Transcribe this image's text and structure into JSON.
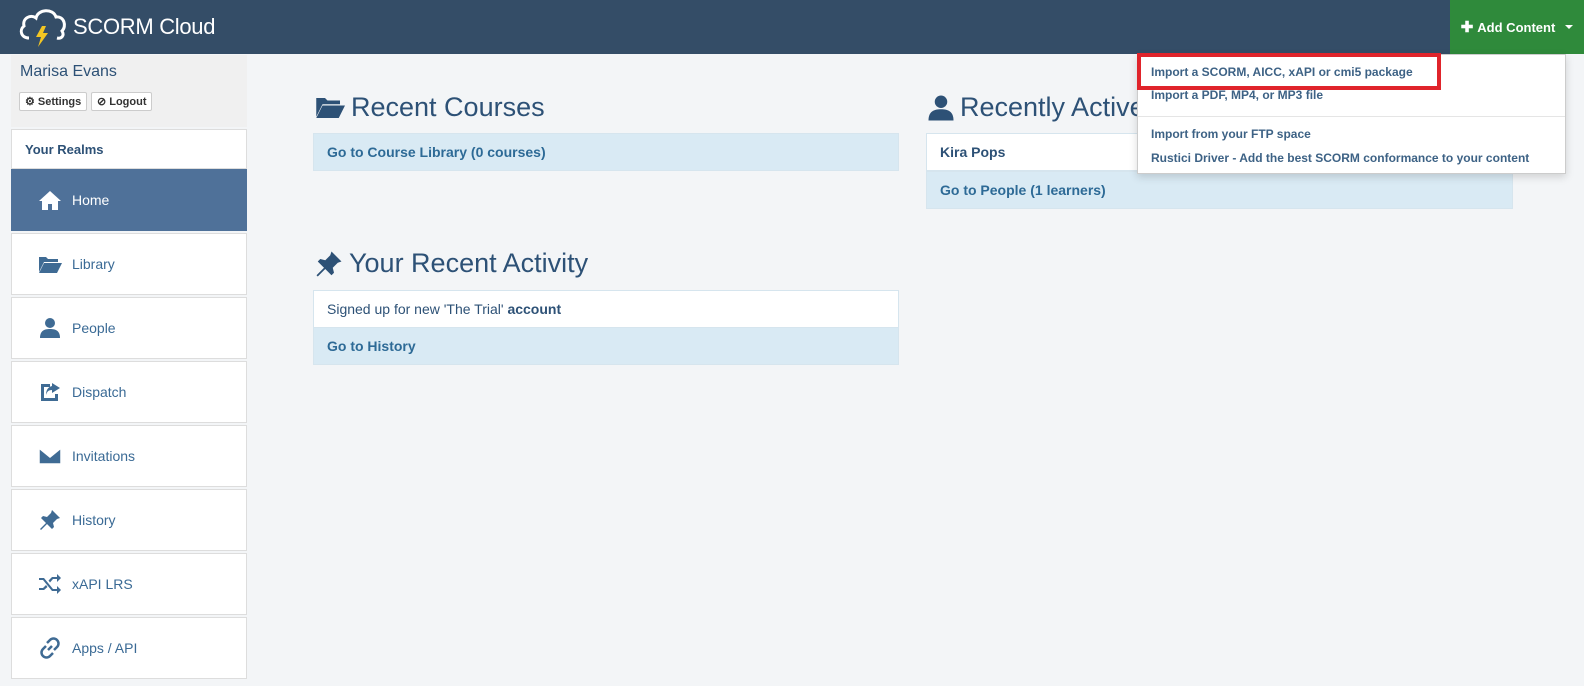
{
  "header": {
    "app_name": "SCORM Cloud",
    "add_content_label": "Add Content"
  },
  "user": {
    "name": "Marisa Evans",
    "settings_label": "Settings",
    "logout_label": "Logout"
  },
  "sidebar": {
    "realms_label": "Your Realms",
    "items": [
      {
        "label": "Home",
        "icon": "home-icon",
        "active": true
      },
      {
        "label": "Library",
        "icon": "folder-open-icon"
      },
      {
        "label": "People",
        "icon": "user-icon"
      },
      {
        "label": "Dispatch",
        "icon": "share-icon"
      },
      {
        "label": "Invitations",
        "icon": "envelope-icon"
      },
      {
        "label": "History",
        "icon": "pushpin-icon"
      },
      {
        "label": "xAPI LRS",
        "icon": "shuffle-icon"
      },
      {
        "label": "Apps / API",
        "icon": "link-icon"
      }
    ]
  },
  "recent_courses": {
    "title": "Recent Courses",
    "link": "Go to Course Library (0 courses)"
  },
  "recently_active": {
    "title": "Recently Active",
    "learner": "Kira Pops",
    "link": "Go to People (1 learners)"
  },
  "recent_activity": {
    "title": "Your Recent Activity",
    "entry_prefix": "Signed up for new 'The Trial' ",
    "entry_suffix": "account",
    "link": "Go to History"
  },
  "add_content_menu": {
    "items": [
      "Import a SCORM, AICC, xAPI or cmi5 package",
      "Import a PDF, MP4, or MP3 file",
      "Import from your FTP space",
      "Rustici Driver - Add the best SCORM conformance to your content"
    ]
  },
  "colors": {
    "topbar": "#344d67",
    "add_button": "#2f8a3b",
    "active_nav": "#4f7199",
    "highlight": "#e0242b"
  }
}
